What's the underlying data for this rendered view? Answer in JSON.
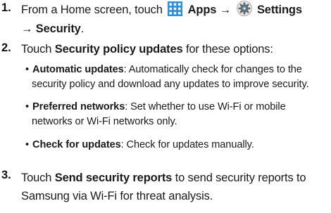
{
  "steps": [
    {
      "number": "1.",
      "prefix": "From a Home screen, touch",
      "apps_label": "Apps",
      "arrow1": "→",
      "settings_label": "Settings",
      "arrow2": "→",
      "security_label": "Security",
      "period": "."
    },
    {
      "number": "2.",
      "prefix": "Touch",
      "bold": "Security policy updates",
      "suffix": "for these options:",
      "bullets": [
        {
          "term": "Automatic updates",
          "line1": ": Automatically check for changes to the",
          "line2": "security policy and download any updates to improve security."
        },
        {
          "term": "Preferred networks",
          "line1": ": Set whether to use Wi-Fi or mobile",
          "line2": "networks or Wi-Fi networks only."
        },
        {
          "term": "Check for updates",
          "line1": ": Check for updates manually.",
          "line2": ""
        }
      ]
    },
    {
      "number": "3.",
      "prefix": "Touch",
      "bold": "Send security reports",
      "suffix_line1": "to send security reports to",
      "suffix_line2": "Samsung via Wi-Fi for threat analysis."
    }
  ],
  "icons": {
    "apps": "apps-grid-icon",
    "settings": "settings-gear-icon",
    "apps_color": "#2f8fd8",
    "settings_color": "#6a6a6a"
  }
}
